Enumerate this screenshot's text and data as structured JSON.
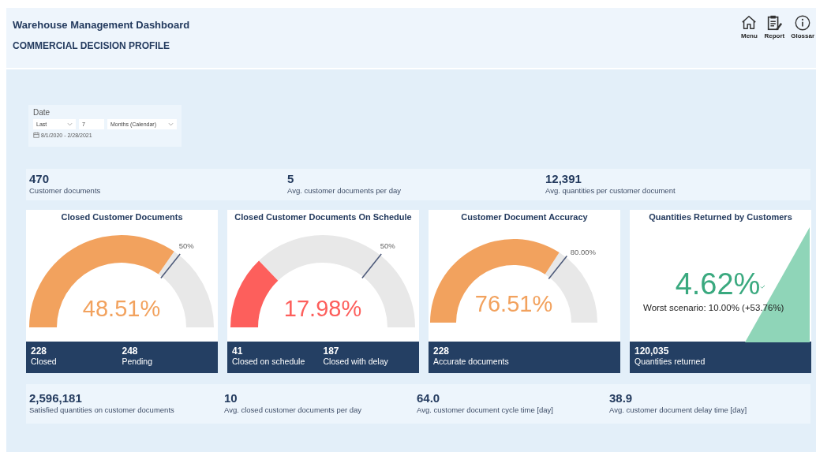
{
  "header": {
    "title": "Warehouse Management Dashboard",
    "subtitle": "COMMERCIAL DECISION PROFILE",
    "nav": [
      {
        "kind": "home",
        "label": "Menu"
      },
      {
        "kind": "report",
        "label": "Report"
      },
      {
        "kind": "info",
        "label": "Glossar"
      }
    ]
  },
  "date_filter": {
    "label": "Date",
    "period": "Last",
    "count": "7",
    "unit": "Months (Calendar)",
    "range": "8/1/2020 - 2/28/2021"
  },
  "summary": [
    {
      "value": "470",
      "label": "Customer documents"
    },
    {
      "value": "5",
      "label": "Avg. customer documents per day"
    },
    {
      "value": "12,391",
      "label": "Avg. quantities per customer document"
    }
  ],
  "cards": [
    {
      "kind": "gauge",
      "title": "Closed Customer Documents",
      "value": "48.51%",
      "target_label": "50%",
      "color": "#f2a25e",
      "stats": [
        {
          "value": "228",
          "label": "Closed"
        },
        {
          "value": "248",
          "label": "Pending"
        }
      ]
    },
    {
      "kind": "gauge",
      "title": "Closed Customer Documents On Schedule",
      "value": "17.98%",
      "target_label": "50%",
      "color": "#fd5f5c",
      "stats": [
        {
          "value": "41",
          "label": "Closed on schedule"
        },
        {
          "value": "187",
          "label": "Closed with delay"
        }
      ]
    },
    {
      "kind": "gauge",
      "title": "Customer Document Accuracy",
      "value": "76.51%",
      "target_label": "80.00%",
      "color": "#f2a25e",
      "stats": [
        {
          "value": "228",
          "label": "Accurate documents"
        }
      ]
    },
    {
      "kind": "kpi",
      "title": "Quantities Returned by Customers",
      "value": "4.62%",
      "note": "Worst scenario: 10.00% (+53.76%)",
      "color": "#3aa97f",
      "stats": [
        {
          "value": "120,035",
          "label": "Quantities returned"
        }
      ]
    }
  ],
  "footer_stats": [
    {
      "value": "2,596,181",
      "label": "Satisfied quantities on customer documents"
    },
    {
      "value": "10",
      "label": "Avg. closed customer documents per day"
    },
    {
      "value": "64.0",
      "label": "Avg. customer document cycle time [day]"
    },
    {
      "value": "38.9",
      "label": "Avg. customer document delay time [day]"
    }
  ]
}
